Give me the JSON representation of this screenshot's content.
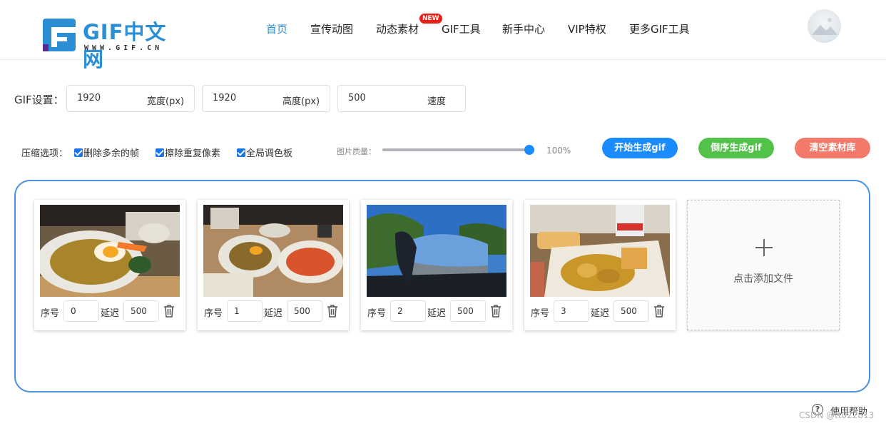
{
  "header": {
    "logo_text": "GIF中文网",
    "logo_sub": "WWW.GIF.CN",
    "nav": [
      {
        "label": "首页",
        "active": true
      },
      {
        "label": "宣传动图",
        "active": false
      },
      {
        "label": "动态素材",
        "active": false
      },
      {
        "label": "GIF工具",
        "active": false
      },
      {
        "label": "新手中心",
        "active": false
      },
      {
        "label": "VIP特权",
        "active": false
      },
      {
        "label": "更多GIF工具",
        "active": false
      }
    ],
    "new_badge": "NEW",
    "accent_color": "#2c8fd6"
  },
  "settings": {
    "label": "GIF设置：",
    "width": {
      "value": "1920",
      "unit": "宽度(px)"
    },
    "height": {
      "value": "1920",
      "unit": "高度(px)"
    },
    "speed": {
      "value": "500",
      "unit": "速度"
    }
  },
  "compression": {
    "label": "压缩选项：",
    "options": [
      {
        "label": "删除多余的帧",
        "checked": true
      },
      {
        "label": "擦除重复像素",
        "checked": true
      },
      {
        "label": "全局调色板",
        "checked": true
      }
    ],
    "quality_label": "图片质量：",
    "quality_value": "100%",
    "quality_fraction": 1.0
  },
  "actions": {
    "start": {
      "label": "开始生成gif",
      "color": "#1a8cff"
    },
    "reverse": {
      "label": "倒序生成gif",
      "color": "#52c24a"
    },
    "clear": {
      "label": "清空素材库",
      "color": "#f37a6a"
    }
  },
  "frames": {
    "index_label": "序号",
    "delay_label": "延迟",
    "items": [
      {
        "index": "0",
        "delay": "500",
        "thumb": "food-plate-egg"
      },
      {
        "index": "1",
        "delay": "500",
        "thumb": "food-table-two-plates"
      },
      {
        "index": "2",
        "delay": "500",
        "thumb": "car-side-mirror-sky"
      },
      {
        "index": "3",
        "delay": "500",
        "thumb": "fried-chicken-waffle"
      }
    ]
  },
  "add_file": {
    "label": "点击添加文件"
  },
  "help": {
    "label": "使用帮助",
    "icon": "question-circle-icon"
  },
  "watermark": "CSDN @tt022813"
}
